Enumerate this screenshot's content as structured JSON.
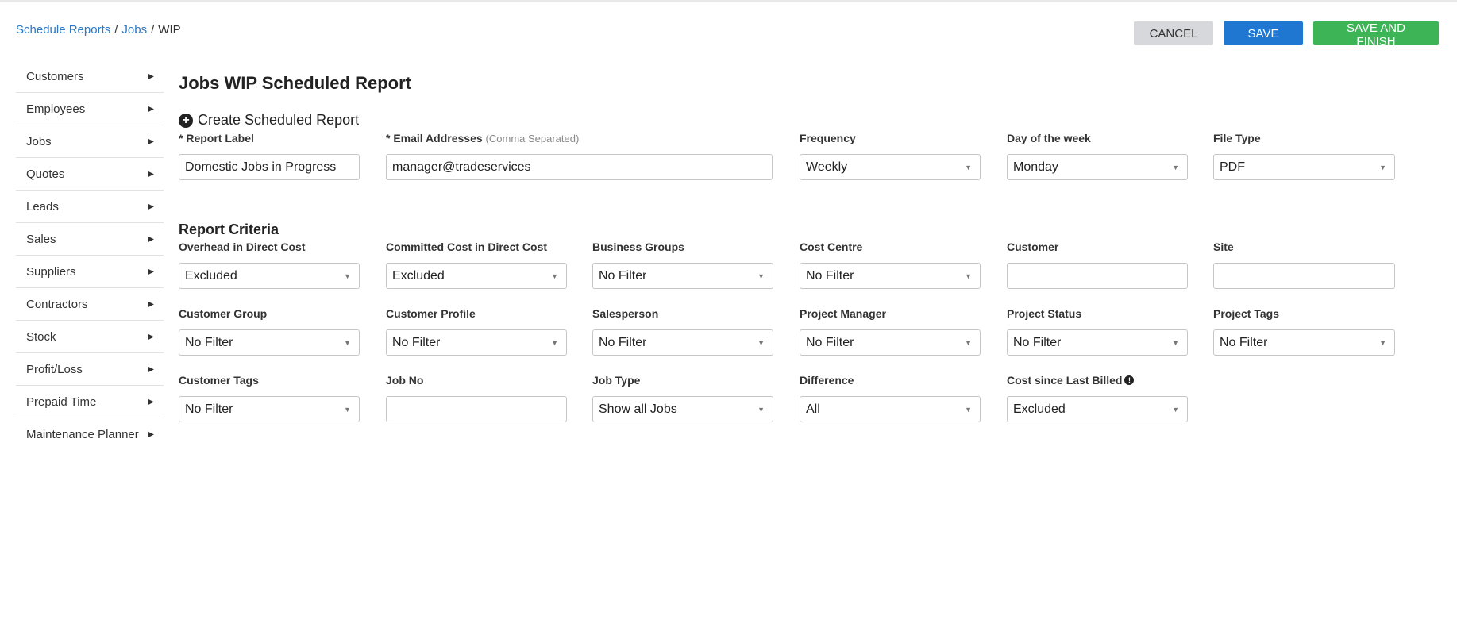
{
  "breadcrumb": {
    "item1": "Schedule Reports",
    "item2": "Jobs",
    "current": "WIP",
    "separator": "/"
  },
  "toolbar": {
    "cancel_label": "CANCEL",
    "save_label": "SAVE",
    "save_finish_label": "SAVE AND FINISH"
  },
  "sidebar": {
    "items": [
      {
        "label": "Customers"
      },
      {
        "label": "Employees"
      },
      {
        "label": "Jobs"
      },
      {
        "label": "Quotes"
      },
      {
        "label": "Leads"
      },
      {
        "label": "Sales"
      },
      {
        "label": "Suppliers"
      },
      {
        "label": "Contractors"
      },
      {
        "label": "Stock"
      },
      {
        "label": "Profit/Loss"
      },
      {
        "label": "Prepaid Time"
      },
      {
        "label": "Maintenance Planner"
      }
    ]
  },
  "icons": {
    "sidebar_arrow": "▶",
    "dropdown_caret": "▼",
    "plus": "+",
    "info": "!"
  },
  "colors": {
    "link": "#2b78c5",
    "save": "#1f77d1",
    "save_finish": "#3db557",
    "cancel": "#d6d8db"
  },
  "page": {
    "title": "Jobs WIP Scheduled Report",
    "subtitle": "Create Scheduled Report",
    "criteria_title": "Report Criteria"
  },
  "form": {
    "report_label": {
      "label": "* Report Label",
      "value": "Domestic Jobs in Progress"
    },
    "email": {
      "label": "* Email Addresses",
      "hint": "(Comma Separated)",
      "value": "manager@tradeservices"
    },
    "frequency": {
      "label": "Frequency",
      "value": "Weekly"
    },
    "day_of_week": {
      "label": "Day of the week",
      "value": "Monday"
    },
    "file_type": {
      "label": "File Type",
      "value": "PDF"
    }
  },
  "criteria": {
    "overhead": {
      "label": "Overhead in Direct Cost",
      "value": "Excluded"
    },
    "committed": {
      "label": "Committed Cost in Direct Cost",
      "value": "Excluded"
    },
    "business_groups": {
      "label": "Business Groups",
      "value": "No Filter"
    },
    "cost_centre": {
      "label": "Cost Centre",
      "value": "No Filter"
    },
    "customer": {
      "label": "Customer",
      "value": ""
    },
    "site": {
      "label": "Site",
      "value": ""
    },
    "customer_group": {
      "label": "Customer Group",
      "value": "No Filter"
    },
    "customer_profile": {
      "label": "Customer Profile",
      "value": "No Filter"
    },
    "salesperson": {
      "label": "Salesperson",
      "value": "No Filter"
    },
    "project_manager": {
      "label": "Project Manager",
      "value": "No Filter"
    },
    "project_status": {
      "label": "Project Status",
      "value": "No Filter"
    },
    "project_tags": {
      "label": "Project Tags",
      "value": "No Filter"
    },
    "customer_tags": {
      "label": "Customer Tags",
      "value": "No Filter"
    },
    "job_no": {
      "label": "Job No",
      "value": ""
    },
    "job_type": {
      "label": "Job Type",
      "value": "Show all Jobs"
    },
    "difference": {
      "label": "Difference",
      "value": "All"
    },
    "cost_since_billed": {
      "label": "Cost since Last Billed",
      "value": "Excluded"
    }
  }
}
